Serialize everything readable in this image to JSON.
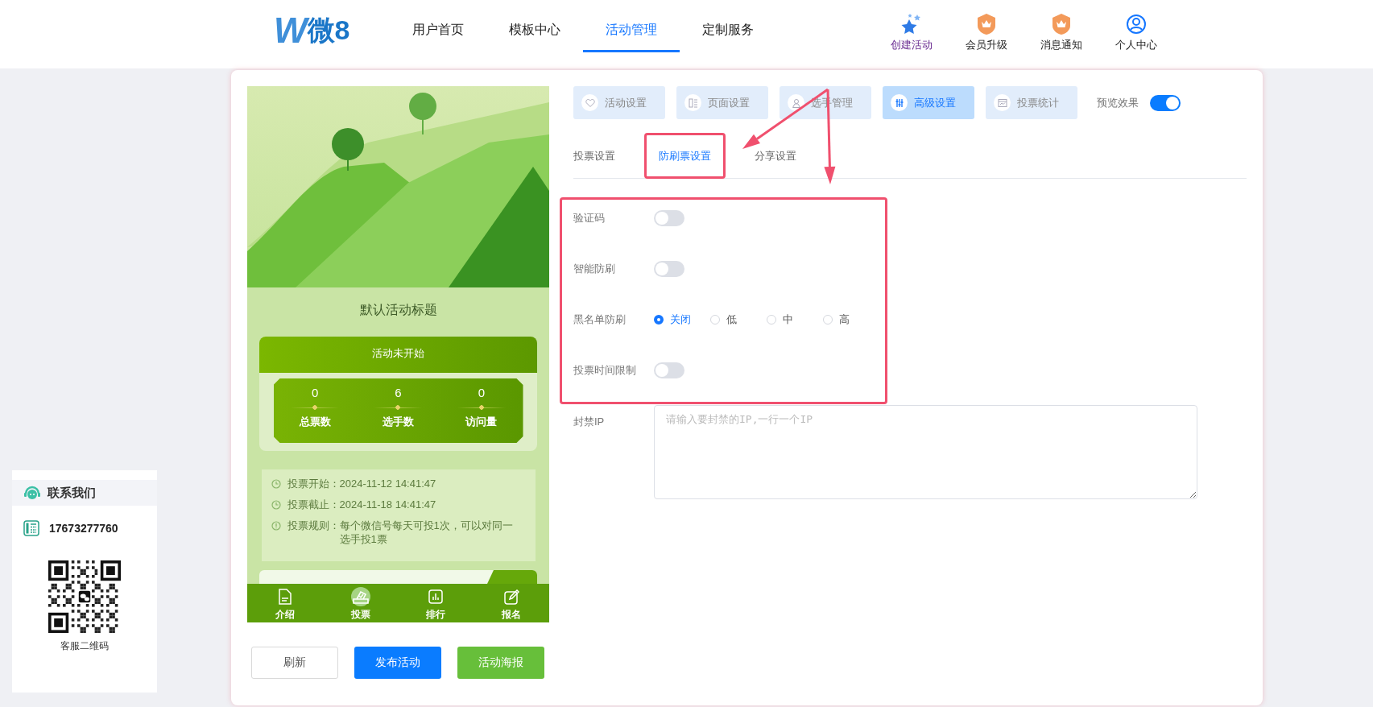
{
  "header": {
    "logo": {
      "mark": "W",
      "text": "微8"
    },
    "nav": [
      {
        "label": "用户首页",
        "selected": false
      },
      {
        "label": "模板中心",
        "selected": false
      },
      {
        "label": "活动管理",
        "selected": true
      },
      {
        "label": "定制服务",
        "selected": false
      }
    ],
    "actions": [
      {
        "label": "创建活动"
      },
      {
        "label": "会员升级"
      },
      {
        "label": "消息通知"
      },
      {
        "label": "个人中心"
      }
    ]
  },
  "preview": {
    "title": "默认活动标题",
    "status": "活动未开始",
    "stats": [
      {
        "value": "0",
        "label": "总票数"
      },
      {
        "value": "6",
        "label": "选手数"
      },
      {
        "value": "0",
        "label": "访问量"
      }
    ],
    "info": [
      {
        "kind": "clock",
        "label": "投票开始：",
        "value": "2024-11-12 14:41:47"
      },
      {
        "kind": "clock",
        "label": "投票截止：",
        "value": "2024-11-18 14:41:47"
      },
      {
        "kind": "info",
        "label": "投票规则：",
        "value": "每个微信号每天可投1次，可以对同一选手投1票"
      }
    ],
    "nav": [
      {
        "label": "介绍",
        "selected": false
      },
      {
        "label": "投票",
        "selected": true
      },
      {
        "label": "排行",
        "selected": false
      },
      {
        "label": "报名",
        "selected": false
      }
    ]
  },
  "buttons": [
    {
      "label": "刷新",
      "kind": "default"
    },
    {
      "label": "发布活动",
      "kind": "primary"
    },
    {
      "label": "活动海报",
      "kind": "success"
    }
  ],
  "settings": {
    "tabs": [
      {
        "label": "活动设置",
        "selected": false
      },
      {
        "label": "页面设置",
        "selected": false
      },
      {
        "label": "选手管理",
        "selected": false
      },
      {
        "label": "高级设置",
        "selected": true
      },
      {
        "label": "投票统计",
        "selected": false
      }
    ],
    "preview_toggle": {
      "label": "预览效果",
      "on": true
    },
    "subtabs": [
      {
        "label": "投票设置",
        "selected": false,
        "highlighted": false
      },
      {
        "label": "防刷票设置",
        "selected": true,
        "highlighted": true
      },
      {
        "label": "分享设置",
        "selected": false,
        "highlighted": false
      }
    ],
    "fields": [
      {
        "kind": "switch",
        "label": "验证码",
        "on": false,
        "highlighted": true
      },
      {
        "kind": "switch",
        "label": "智能防刷",
        "on": false,
        "highlighted": true
      },
      {
        "kind": "radio",
        "label": "黑名单防刷",
        "highlighted": true,
        "options": [
          {
            "label": "关闭",
            "selected": true
          },
          {
            "label": "低",
            "selected": false
          },
          {
            "label": "中",
            "selected": false
          },
          {
            "label": "高",
            "selected": false
          }
        ]
      },
      {
        "kind": "switch",
        "label": "投票时间限制",
        "on": false,
        "highlighted": true
      },
      {
        "kind": "textarea",
        "label": "封禁IP",
        "placeholder": "请输入要封禁的IP,一行一个IP",
        "highlighted": false
      }
    ]
  },
  "contact": {
    "title": "联系我们",
    "phone": "17673277760",
    "qr_caption": "客服二维码"
  }
}
